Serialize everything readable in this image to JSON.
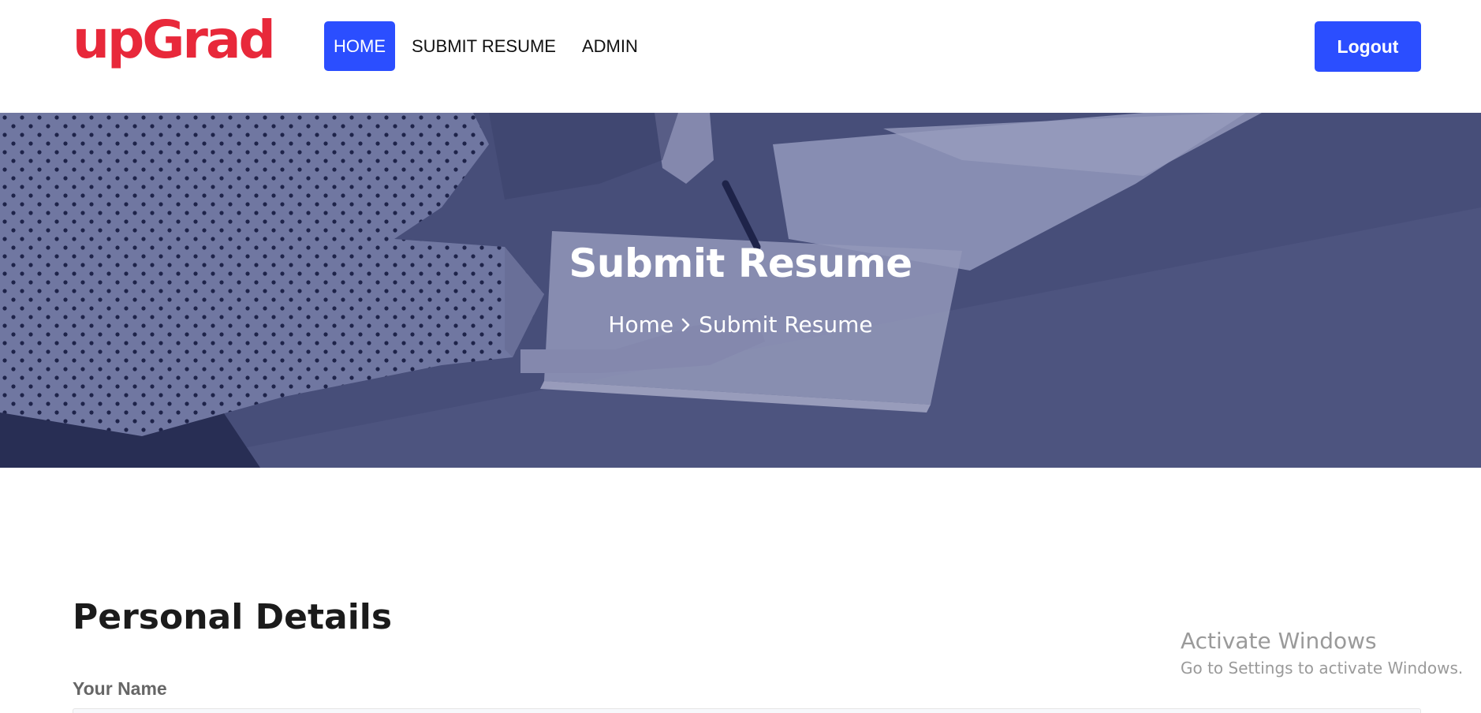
{
  "header": {
    "logo_text": "upGrad",
    "nav": [
      {
        "label": "HOME",
        "active": true
      },
      {
        "label": "SUBMIT RESUME",
        "active": false
      },
      {
        "label": "ADMIN",
        "active": false
      }
    ],
    "logout_label": "Logout"
  },
  "hero": {
    "title": "Submit Resume",
    "breadcrumb": {
      "home": "Home",
      "current": "Submit Resume"
    }
  },
  "form": {
    "section_title": "Personal Details",
    "name_label": "Your Name"
  },
  "watermark": {
    "title": "Activate Windows",
    "subtitle": "Go to Settings to activate Windows."
  },
  "colors": {
    "brand_red": "#e8283a",
    "accent_blue": "#2b4eff"
  },
  "icons": {
    "breadcrumb_separator": "chevron-right-icon"
  }
}
